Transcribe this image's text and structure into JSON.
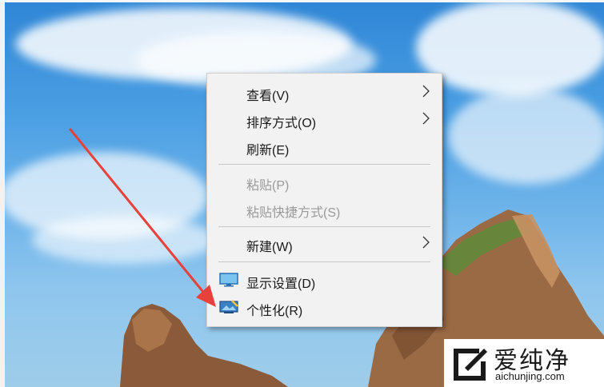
{
  "context_menu": {
    "items": [
      {
        "label": "查看(V)",
        "has_submenu": true,
        "enabled": true
      },
      {
        "label": "排序方式(O)",
        "has_submenu": true,
        "enabled": true
      },
      {
        "label": "刷新(E)",
        "has_submenu": false,
        "enabled": true
      },
      {
        "label": "粘贴(P)",
        "has_submenu": false,
        "enabled": false
      },
      {
        "label": "粘贴快捷方式(S)",
        "has_submenu": false,
        "enabled": false
      },
      {
        "label": "新建(W)",
        "has_submenu": true,
        "enabled": true
      },
      {
        "label": "显示设置(D)",
        "has_submenu": false,
        "enabled": true,
        "icon": "display-icon"
      },
      {
        "label": "个性化(R)",
        "has_submenu": false,
        "enabled": true,
        "icon": "personalize-icon"
      }
    ]
  },
  "watermark": {
    "name": "爱纯净",
    "url": "aichunjing.com"
  },
  "colors": {
    "menu_bg": "#f2f2f2",
    "annotation_arrow": "#e8403a"
  }
}
